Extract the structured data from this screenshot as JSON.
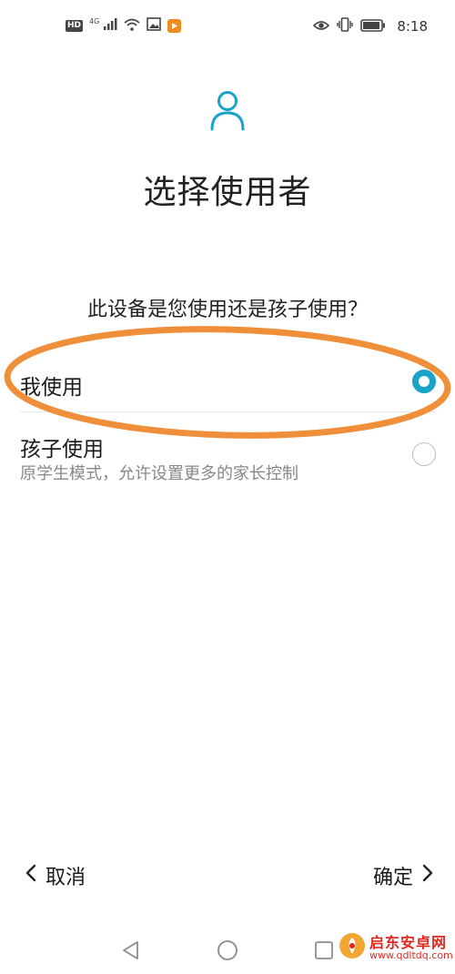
{
  "status_bar": {
    "hd_badge": "HD",
    "network": "4G",
    "time": "8:18",
    "icons": [
      "hd-icon",
      "signal-icon",
      "wifi-icon",
      "gallery-icon",
      "app-icon",
      "eye-icon",
      "vibrate-icon",
      "battery-icon"
    ]
  },
  "header": {
    "icon": "person-icon",
    "title": "选择使用者"
  },
  "question": "此设备是您使用还是孩子使用？",
  "options": [
    {
      "label": "我使用",
      "selected": true
    },
    {
      "label": "孩子使用",
      "description": "原学生模式，允许设置更多的家长控制",
      "selected": false
    }
  ],
  "actions": {
    "cancel_label": "取消",
    "confirm_label": "确定"
  },
  "nav_bar": {
    "icons": [
      "back-icon",
      "home-icon",
      "recents-icon"
    ]
  },
  "watermark": {
    "title": "启东安卓网",
    "url": "www.qdltdq.com"
  },
  "colors": {
    "accent": "#1aa3c8",
    "annotation": "#ef8f3a",
    "watermark": "#e0281f"
  }
}
